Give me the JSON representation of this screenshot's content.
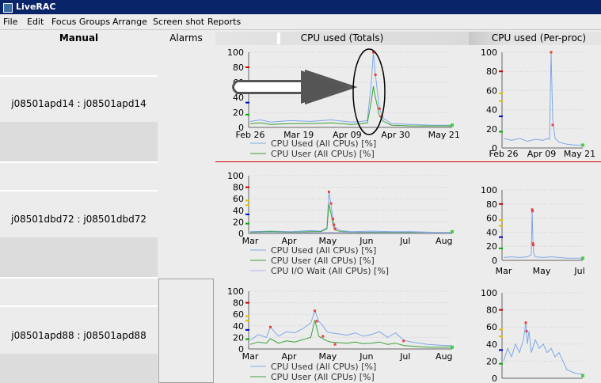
{
  "window": {
    "title": "LiveRAC"
  },
  "menu": [
    "File",
    "Edit",
    "Focus Groups",
    "Arrange",
    "Screen shot",
    "Reports"
  ],
  "columns": {
    "rows_header": "Manual",
    "alarms": "Alarms",
    "totals": "CPU used (Totals)",
    "perproc": "CPU used (Per-proc)"
  },
  "rows": [
    {
      "label": "j08501apd14 : j08501apd14"
    },
    {
      "label": "j08501dbd72 : j08501dbd72"
    },
    {
      "label": "j08501apd88 : j08501apd88"
    }
  ],
  "colors": {
    "cpu_used": "#7fa8e8",
    "cpu_user": "#3aa03a",
    "cpu_iowait": "#b0b0f0",
    "peak_marker": "#e84040",
    "end_marker": "#40d040",
    "selection_line": "#cc0000"
  },
  "chart_data": [
    {
      "type": "line",
      "name": "row1-totals",
      "ylim": [
        0,
        100
      ],
      "yticks": [
        0,
        20,
        40,
        60,
        80,
        100
      ],
      "xticks": [
        "Feb 26",
        "Mar 19",
        "Apr 09",
        "Apr 30",
        "May 21"
      ],
      "legend": [
        "CPU Used (All CPUs) [%]",
        "CPU User (All CPUs) [%]"
      ],
      "series": [
        {
          "name": "CPU Used (All CPUs) [%]",
          "x": [
            0,
            5,
            10,
            20,
            30,
            40,
            50,
            55,
            58,
            60,
            61,
            62,
            64,
            66,
            70,
            80,
            90,
            100
          ],
          "y": [
            8,
            10,
            7,
            9,
            8,
            10,
            7,
            8,
            9,
            60,
            100,
            70,
            25,
            12,
            5,
            4,
            3,
            3
          ]
        },
        {
          "name": "CPU User (All CPUs) [%]",
          "x": [
            0,
            5,
            10,
            20,
            30,
            40,
            50,
            55,
            58,
            60,
            61,
            62,
            64,
            66,
            70,
            80,
            90,
            100
          ],
          "y": [
            5,
            6,
            4,
            5,
            5,
            6,
            4,
            5,
            6,
            35,
            55,
            40,
            15,
            8,
            3,
            2,
            2,
            2
          ]
        }
      ],
      "markers": [
        [
          61,
          100
        ],
        [
          62,
          70
        ],
        [
          64,
          25
        ],
        [
          65,
          15
        ]
      ]
    },
    {
      "type": "line",
      "name": "row1-perproc",
      "ylim": [
        0,
        100
      ],
      "yticks": [
        0,
        20,
        40,
        60,
        80,
        100
      ],
      "xticks": [
        "Feb 26",
        "Apr 09",
        "May 21"
      ],
      "series": [
        {
          "name": "CPU Used (All CPUs) [%]",
          "x": [
            0,
            10,
            20,
            30,
            40,
            50,
            55,
            58,
            60,
            62,
            65,
            70,
            80,
            90,
            100
          ],
          "y": [
            10,
            8,
            10,
            7,
            9,
            8,
            10,
            9,
            100,
            30,
            10,
            6,
            4,
            3,
            3
          ]
        }
      ],
      "markers": [
        [
          60,
          100
        ],
        [
          62,
          24
        ]
      ]
    },
    {
      "type": "line",
      "name": "row2-totals",
      "ylim": [
        0,
        100
      ],
      "yticks": [
        0,
        20,
        40,
        60,
        80,
        100
      ],
      "xticks": [
        "Mar",
        "Apr",
        "May",
        "Jun",
        "Jul",
        "Aug"
      ],
      "legend": [
        "CPU Used (All CPUs) [%]",
        "CPU User (All CPUs) [%]",
        "CPU I/O Wait (All CPUs) [%]"
      ],
      "series": [
        {
          "name": "CPU Used (All CPUs) [%]",
          "x": [
            0,
            10,
            20,
            30,
            35,
            38,
            39,
            40,
            41,
            42,
            45,
            50,
            60,
            70,
            80,
            90,
            100
          ],
          "y": [
            3,
            4,
            3,
            5,
            4,
            10,
            72,
            50,
            25,
            10,
            5,
            3,
            4,
            3,
            3,
            2,
            2
          ]
        },
        {
          "name": "CPU User (All CPUs) [%]",
          "x": [
            0,
            10,
            20,
            30,
            35,
            38,
            39,
            40,
            41,
            42,
            45,
            50,
            60,
            70,
            80,
            90,
            100
          ],
          "y": [
            2,
            3,
            2,
            3,
            3,
            8,
            50,
            35,
            15,
            6,
            3,
            2,
            2,
            2,
            2,
            1,
            1
          ]
        },
        {
          "name": "CPU I/O Wait (All CPUs) [%]",
          "x": [
            0,
            20,
            40,
            60,
            80,
            100
          ],
          "y": [
            1,
            1,
            2,
            1,
            1,
            1
          ]
        }
      ],
      "markers": [
        [
          39,
          72
        ],
        [
          40,
          52
        ],
        [
          41,
          25
        ],
        [
          41.5,
          15
        ],
        [
          42,
          8
        ]
      ]
    },
    {
      "type": "line",
      "name": "row2-perproc",
      "ylim": [
        0,
        100
      ],
      "yticks": [
        0,
        20,
        40,
        60,
        80,
        100
      ],
      "xticks": [
        "Mar",
        "May",
        "Jul"
      ],
      "series": [
        {
          "name": "CPU Used (All CPUs) [%]",
          "x": [
            0,
            10,
            20,
            30,
            35,
            36,
            37,
            38,
            40,
            50,
            60,
            70,
            80,
            90,
            100
          ],
          "y": [
            4,
            5,
            4,
            5,
            8,
            72,
            30,
            10,
            5,
            4,
            5,
            4,
            3,
            3,
            3
          ]
        }
      ],
      "markers": [
        [
          36,
          72
        ],
        [
          36.5,
          70
        ],
        [
          37,
          24
        ],
        [
          37.5,
          22
        ]
      ]
    },
    {
      "type": "line",
      "name": "row3-totals",
      "ylim": [
        0,
        100
      ],
      "yticks": [
        0,
        20,
        40,
        60,
        80,
        100
      ],
      "xticks": [
        "Mar",
        "Apr",
        "May",
        "Jun",
        "Jul",
        "Aug"
      ],
      "legend": [
        "CPU Used (All CPUs) [%]",
        "CPU User (All CPUs) [%]"
      ],
      "series": [
        {
          "name": "CPU Used (All CPUs) [%]",
          "x": [
            0,
            4,
            8,
            10,
            14,
            18,
            22,
            26,
            30,
            32,
            34,
            36,
            38,
            40,
            44,
            48,
            52,
            56,
            60,
            64,
            68,
            72,
            76,
            80,
            84,
            88,
            92,
            96,
            100
          ],
          "y": [
            15,
            25,
            20,
            38,
            22,
            30,
            28,
            35,
            45,
            66,
            48,
            40,
            30,
            28,
            26,
            24,
            28,
            22,
            25,
            30,
            20,
            28,
            15,
            12,
            10,
            8,
            7,
            6,
            6
          ]
        },
        {
          "name": "CPU User (All CPUs) [%]",
          "x": [
            0,
            4,
            8,
            10,
            14,
            18,
            22,
            26,
            30,
            32,
            34,
            36,
            38,
            40,
            44,
            48,
            52,
            56,
            60,
            64,
            68,
            72,
            76,
            80,
            84,
            88,
            92,
            96,
            100
          ],
          "y": [
            8,
            12,
            10,
            18,
            10,
            14,
            12,
            16,
            20,
            50,
            22,
            18,
            14,
            12,
            11,
            10,
            12,
            9,
            10,
            12,
            8,
            10,
            6,
            5,
            4,
            3,
            3,
            3,
            3
          ]
        }
      ],
      "markers": [
        [
          10,
          38
        ],
        [
          32,
          66
        ],
        [
          33,
          48
        ],
        [
          36,
          22
        ],
        [
          42,
          8
        ],
        [
          76,
          14
        ]
      ]
    },
    {
      "type": "line",
      "name": "row3-perproc",
      "ylim": [
        0,
        100
      ],
      "yticks": [
        0,
        20,
        40,
        60,
        80,
        100
      ],
      "xticks": [],
      "series": [
        {
          "name": "CPU Used (All CPUs) [%]",
          "x": [
            0,
            5,
            10,
            15,
            20,
            25,
            28,
            30,
            32,
            35,
            40,
            45,
            50,
            55,
            60,
            65,
            70,
            75,
            80,
            85,
            90,
            95,
            100
          ],
          "y": [
            20,
            35,
            25,
            40,
            30,
            45,
            65,
            40,
            55,
            30,
            45,
            35,
            40,
            30,
            35,
            25,
            30,
            20,
            10,
            8,
            6,
            5,
            5
          ]
        }
      ],
      "markers": [
        [
          28,
          65
        ],
        [
          29,
          55
        ]
      ]
    }
  ]
}
